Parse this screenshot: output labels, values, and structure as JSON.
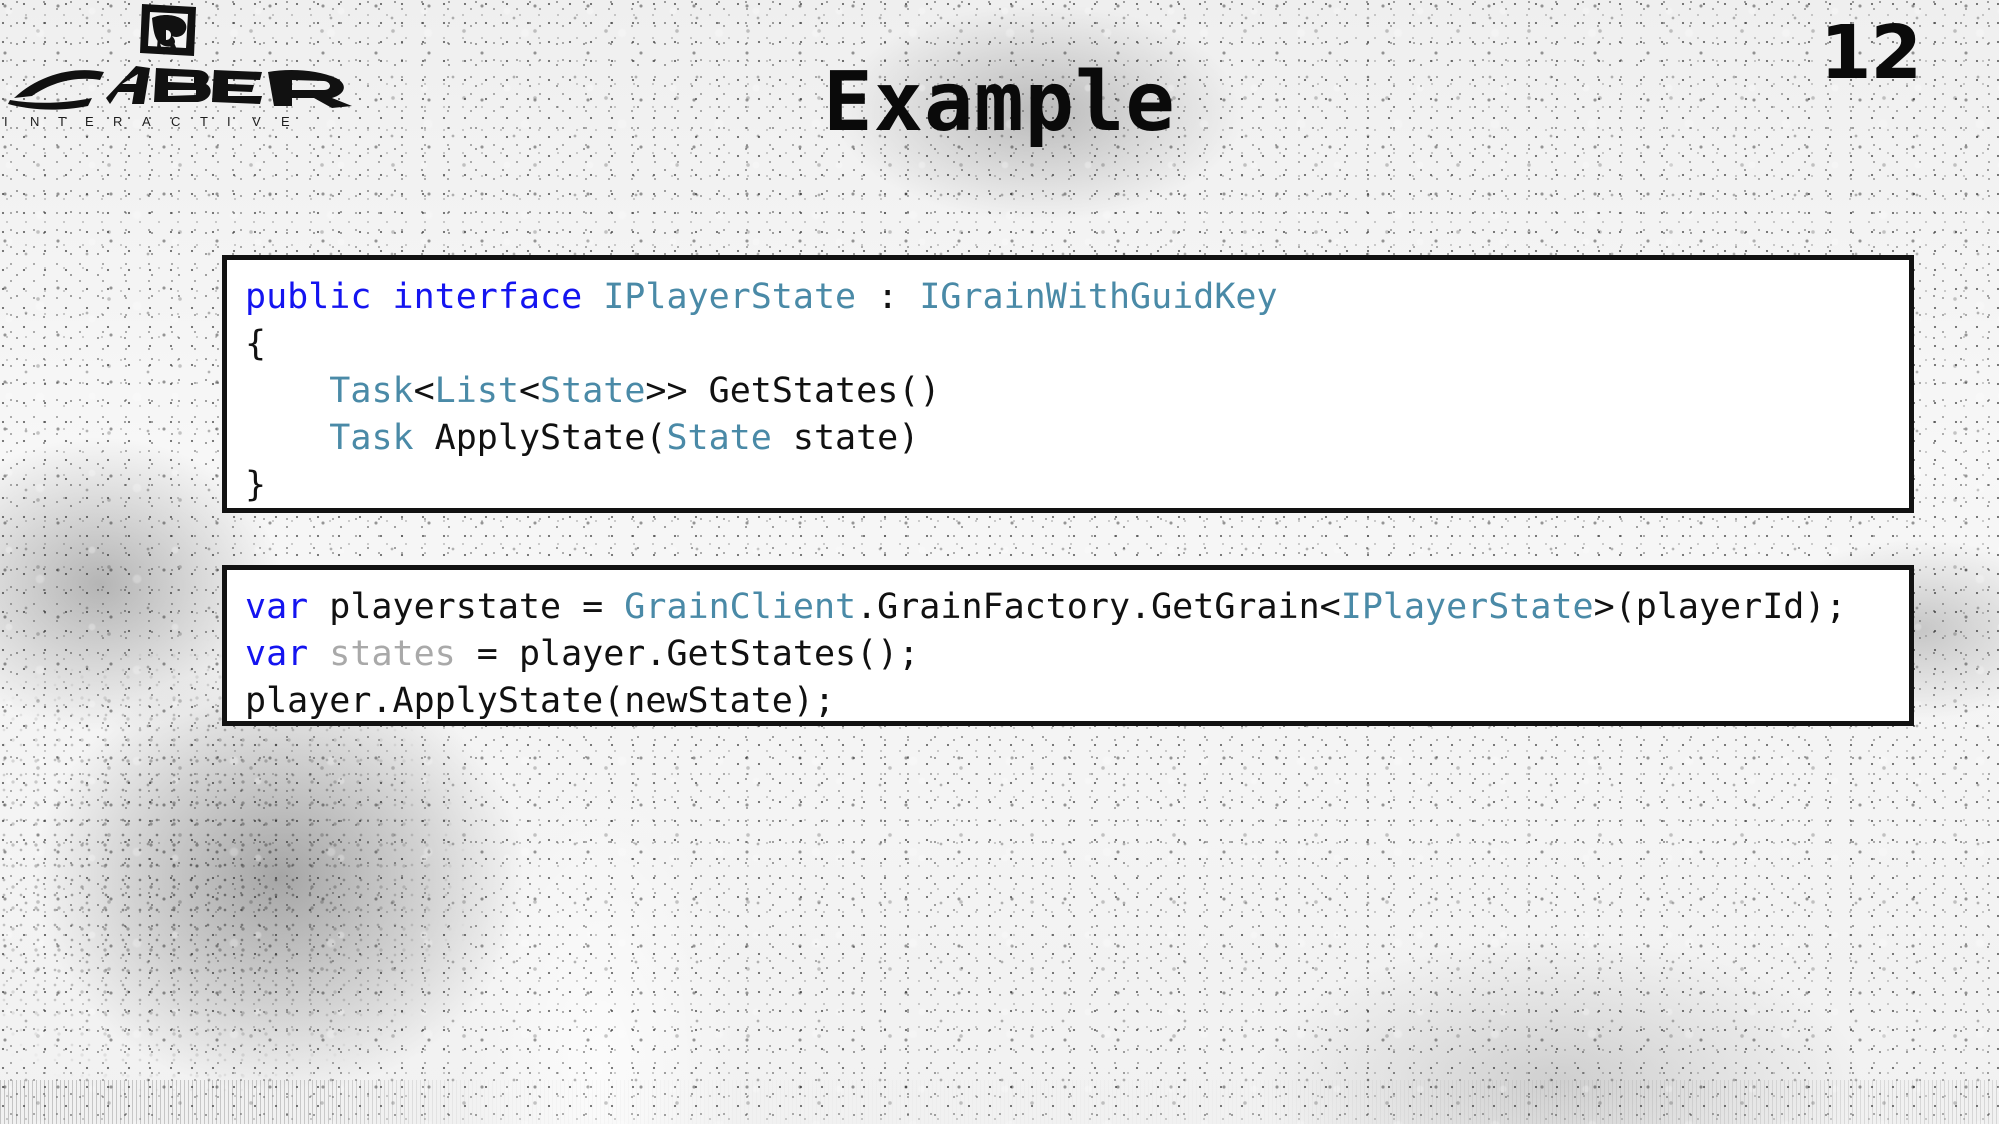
{
  "slide": {
    "title": "Example",
    "number": "12",
    "background": "grunge-concrete-texture"
  },
  "logo": {
    "brand": "SABER",
    "tagline": "I N T E R A C T I V E",
    "icon": "saber-tooth-tiger-icon"
  },
  "colors": {
    "keyword_blue": "#1414f0",
    "type_teal": "#4a8aa7",
    "plain_black": "#111111",
    "dimmed_gray": "#a9a9a9",
    "code_border": "#121212",
    "code_background": "#ffffff"
  },
  "code_blocks": [
    {
      "name": "interface-declaration",
      "language": "csharp",
      "lines": [
        [
          {
            "text": "public interface ",
            "style": "kw"
          },
          {
            "text": "IPlayerState",
            "style": "type"
          },
          {
            "text": " : ",
            "style": "plain"
          },
          {
            "text": "IGrainWithGuidKey",
            "style": "type"
          }
        ],
        [
          {
            "text": "{",
            "style": "plain"
          }
        ],
        [
          {
            "text": "    ",
            "style": "plain"
          },
          {
            "text": "Task",
            "style": "type"
          },
          {
            "text": "<",
            "style": "plain"
          },
          {
            "text": "List",
            "style": "type"
          },
          {
            "text": "<",
            "style": "plain"
          },
          {
            "text": "State",
            "style": "type"
          },
          {
            "text": ">> GetStates()",
            "style": "plain"
          }
        ],
        [
          {
            "text": "    ",
            "style": "plain"
          },
          {
            "text": "Task",
            "style": "type"
          },
          {
            "text": " ApplyState(",
            "style": "plain"
          },
          {
            "text": "State",
            "style": "type"
          },
          {
            "text": " state)",
            "style": "plain"
          }
        ],
        [
          {
            "text": "}",
            "style": "plain"
          }
        ]
      ]
    },
    {
      "name": "client-usage",
      "language": "csharp",
      "lines": [
        [
          {
            "text": "var",
            "style": "kw"
          },
          {
            "text": " playerstate = ",
            "style": "plain"
          },
          {
            "text": "GrainClient",
            "style": "type"
          },
          {
            "text": ".GrainFactory.GetGrain<",
            "style": "plain"
          },
          {
            "text": "IPlayerState",
            "style": "type"
          },
          {
            "text": ">(playerId);",
            "style": "plain"
          }
        ],
        [
          {
            "text": "var",
            "style": "kw"
          },
          {
            "text": " ",
            "style": "plain"
          },
          {
            "text": "states",
            "style": "dim"
          },
          {
            "text": " = player.GetStates();",
            "style": "plain"
          }
        ],
        [
          {
            "text": "player.ApplyState(newState);",
            "style": "plain"
          }
        ]
      ]
    }
  ]
}
